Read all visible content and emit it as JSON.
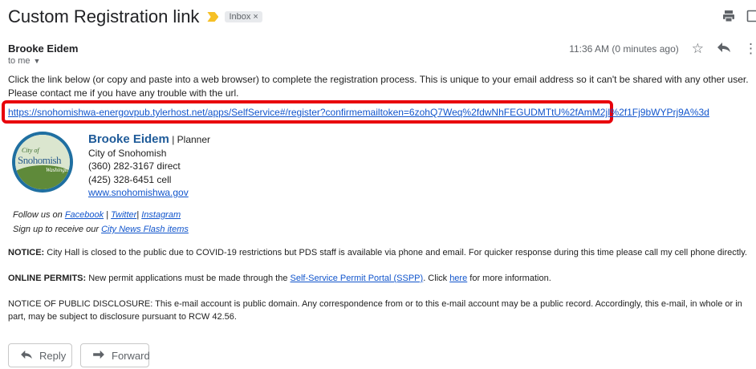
{
  "email": {
    "subject": "Custom Registration link",
    "label": "Inbox",
    "label_close": "×",
    "sender": "Brooke Eidem",
    "recipient": "to me",
    "time": "11:36 AM (0 minutes ago)",
    "body": "Click the link below (or copy and paste into a web browser) to complete the registration process.  This is unique to your email address so it can't be shared with any other user.  Please contact me if you have any trouble with the url.",
    "registration_link": "https://snohomishwa-energovpub.tylerhost.net/apps/SelfService#/register?confirmemailtoken=6zohQ7Weq%2fdwNhFEGUDMTtU%2fAmM2jI%2f1Fj9bWYPrj9A%3d"
  },
  "signature": {
    "logo_city": "City of",
    "logo_name": "Snohomish",
    "logo_tag": "Washington",
    "name": "Brooke Eidem",
    "title": " | Planner",
    "org": "City of Snohomish",
    "phone_direct": "(360) 282-3167 direct",
    "phone_cell": "(425) 328-6451 cell",
    "website": "www.snohomishwa.gov",
    "follow_prefix": "Follow us on ",
    "facebook": "Facebook",
    "sep1": " | ",
    "twitter": "Twitter",
    "sep2": "| ",
    "instagram": "Instagram",
    "signup_prefix": "Sign up to receive our ",
    "news_link": "City News Flash items"
  },
  "notices": {
    "notice_label": "NOTICE:",
    "notice_text": "  City Hall is closed to the public due to COVID-19 restrictions but PDS staff is available via phone and email.  For quicker response during this time please call my cell phone directly.",
    "permits_label": "ONLINE PERMITS:",
    "permits_text": "  New permit applications must be made through the ",
    "portal_link": "Self-Service Permit Portal (SSPP)",
    "permits_mid": ".  Click ",
    "here_link": "here",
    "permits_end": " for more information.",
    "disclosure": "NOTICE OF PUBLIC DISCLOSURE: This e-mail account is public domain. Any correspondence from or to this e-mail account may be a public record. Accordingly, this e-mail, in whole or in part, may be subject to disclosure pursuant to RCW 42.56."
  },
  "actions": {
    "reply": "Reply",
    "forward": "Forward"
  },
  "icons": {
    "print": "print-icon",
    "open_new": "open-in-new-window-icon",
    "star": "star-icon",
    "reply": "reply-icon",
    "forward": "forward-icon",
    "important": "important-marker-icon",
    "dropdown": "chevron-down-icon"
  },
  "colors": {
    "link": "#1155cc",
    "highlight_border": "#e8000b",
    "important_marker": "#f6c026",
    "signature_name": "#1f5b99"
  }
}
